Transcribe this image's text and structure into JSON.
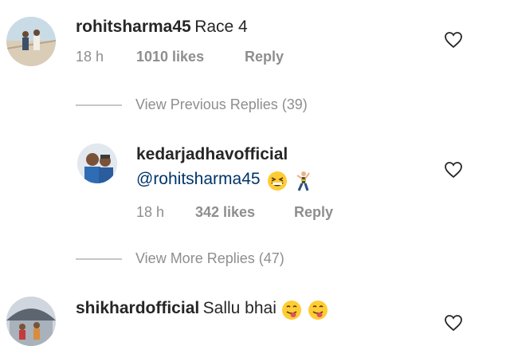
{
  "comments": [
    {
      "username": "rohitsharma45",
      "text": "Race 4",
      "time": "18 h",
      "likes": "1010 likes",
      "reply": "Reply"
    },
    {
      "username": "kedarjadhavofficial",
      "mention": "@rohitsharma45",
      "time": "18 h",
      "likes": "342 likes",
      "reply": "Reply"
    },
    {
      "username": "shikhardofficial",
      "text": "Sallu bhai"
    }
  ],
  "view_previous": "View Previous Replies (39)",
  "view_more": "View More Replies (47)",
  "icons": {
    "heart": "heart-outline-icon",
    "grin": "grinning-squinting-face-emoji",
    "dancer": "man-dancing-emoji",
    "tongue": "face-with-tongue-emoji"
  },
  "colors": {
    "text": "#262626",
    "muted": "#8e8e8e",
    "mention": "#003569"
  }
}
